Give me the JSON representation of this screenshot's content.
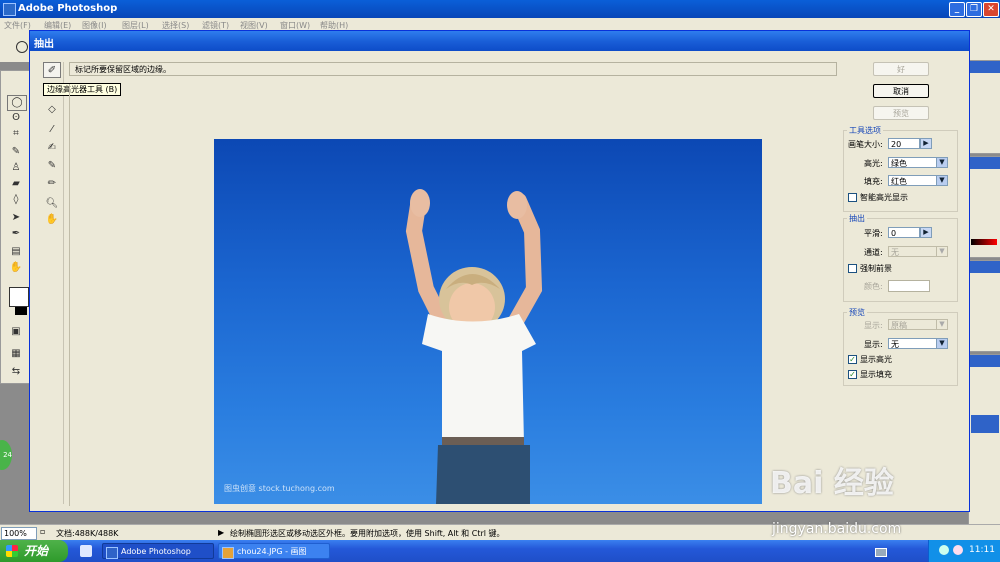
{
  "app": {
    "title": "Adobe Photoshop"
  },
  "menubar": {
    "items": [
      "文件(F)",
      "编辑(E)",
      "图像(I)",
      "图层(L)",
      "选择(S)",
      "滤镜(T)",
      "视图(V)",
      "窗口(W)",
      "帮助(H)"
    ]
  },
  "dialog": {
    "title": "抽出",
    "hint": "标记所要保留区域的边缘。",
    "tooltip": "边缘高光器工具 (B)",
    "photo_watermark": "图虫创意 stock.tuchong.com"
  },
  "buttons": {
    "ok": "好",
    "cancel": "取消",
    "preview": "预览"
  },
  "tool_options": {
    "title": "工具选项",
    "brush_size_label": "画笔大小:",
    "brush_size_value": "20",
    "highlight_label": "高光:",
    "highlight_value": "绿色",
    "fill_label": "填充:",
    "fill_value": "红色",
    "smart_highlight_label": "智能高光显示",
    "smart_highlight_checked": false
  },
  "extraction": {
    "title": "抽出",
    "smooth_label": "平滑:",
    "smooth_value": "0",
    "channel_label": "通道:",
    "channel_value": "无",
    "force_foreground_label": "强制前景",
    "force_foreground_checked": false,
    "color_label": "颜色:"
  },
  "preview_group": {
    "title": "预览",
    "show_label_1": "显示:",
    "show_value_1": "原稿",
    "show_label_2": "显示:",
    "show_value_2": "无",
    "show_highlight_label": "显示高光",
    "show_highlight_checked": true,
    "show_fill_label": "显示填充",
    "show_fill_checked": true
  },
  "statusbar": {
    "zoom": "100%",
    "doc_info": "文档:488K/488K",
    "message": "绘制椭圆形选区或移动选区外框。要用附加选项，使用 Shift, Alt 和 Ctrl 键。"
  },
  "taskbar": {
    "start_label": "开始",
    "tasks": [
      "Adobe Photoshop",
      "chou24.JPG - 画图"
    ],
    "clock": "11:11"
  },
  "overlay": {
    "baidu_logo": "Bai 经验",
    "baidu_url": "jingyan.baidu.com",
    "circle_badge": "24"
  },
  "colors": {
    "highlight": "#2f7dee",
    "photo_sky": "#1b66d0",
    "xp_start": "#2e9a2b"
  }
}
